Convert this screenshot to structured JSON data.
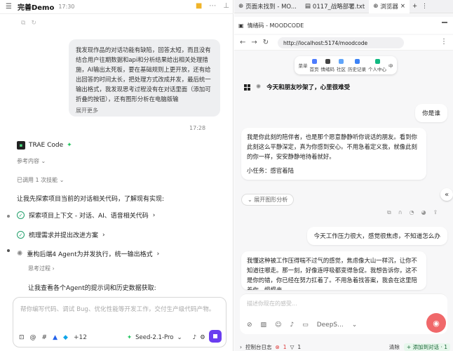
{
  "left": {
    "title": "完善Demo",
    "time": "17:30",
    "user_message": "我发现作品的对话功能有缺陷，回答太短，而且没有结合用户往期数据和api和分析结果给出相关处理措施，AI输出太死板，要在基础规则上更开放，还有给出回答的时间太长，把处理方式改成并发，最后统一输出格式，我发现思考过程没有在对话里面（添加可折叠的按钮），还有图形分析在电脑版输",
    "show_more": "展开更多",
    "timestamp": "17:28",
    "brand": "TRAE Code",
    "refs": "参考内容",
    "skills": "已调用 1 次技能",
    "explore": "让我先探索项目当前的对话相关代码，了解现有实现:",
    "steps": [
      "探索项目上下文 - 对话、AI、语音相关代码",
      "梳理需求并提出改进方案",
      "重构后端4 Agent为并发执行，统一输出格式"
    ],
    "thinking": "思考过程",
    "viewing": "让我查看各个Agent的提示词和历史数据获取:",
    "input_placeholder": "帮你编写代码、调试 Bug、优化性能等开发工作，交付生产级代码产物。",
    "tool_count": "+12",
    "model": "Seed-2.1-Pro"
  },
  "right": {
    "tabs": [
      {
        "label": "页面未找到 - MO..."
      },
      {
        "label": "0117_战略部署.txt"
      },
      {
        "label": "浏览器"
      }
    ],
    "page_header": "情绪码 - MOODCODE",
    "url": "http://localhost:5174/moodcode",
    "nav": [
      "菜单",
      "首页",
      "情绪码",
      "社区",
      "历史记录",
      "个人中心",
      "中"
    ],
    "mood_title": "今天和朋友吵架了，心里很难受",
    "messages": [
      {
        "role": "user",
        "text": "你是谁"
      },
      {
        "role": "assistant",
        "text": "我是你此刻的陪伴者，也是那个愿意静静听你说话的朋友。看到你此刻这么平静深定，真为你感到安心。不用急着定义我，就像此刻的你一样，安安静静地待着就好。",
        "task": "小任务：感官着陆"
      },
      {
        "role": "user",
        "text": "今天工作压力很大，感觉很焦虑，不知道怎么办"
      },
      {
        "role": "assistant",
        "text": "我懂这种被工作压得喘不过气的感觉，焦虑像大山一样沉，让你不知道往哪走。那一刻，好像连呼吸都变得急促。我想告诉你，这不是你的错，你已经在努力扛着了。不用急着找答案，我会在这里陪着你，慢慢来"
      }
    ],
    "expand_analysis": "展开图形分析",
    "input_placeholder": "描述你现在的感受...",
    "model_short": "DeepS...",
    "bottom_left": "控制台日志",
    "bottom_err": "1",
    "bottom_warn": "1",
    "clear": "清除",
    "add_to_chat": "添加到对话 · 1"
  }
}
